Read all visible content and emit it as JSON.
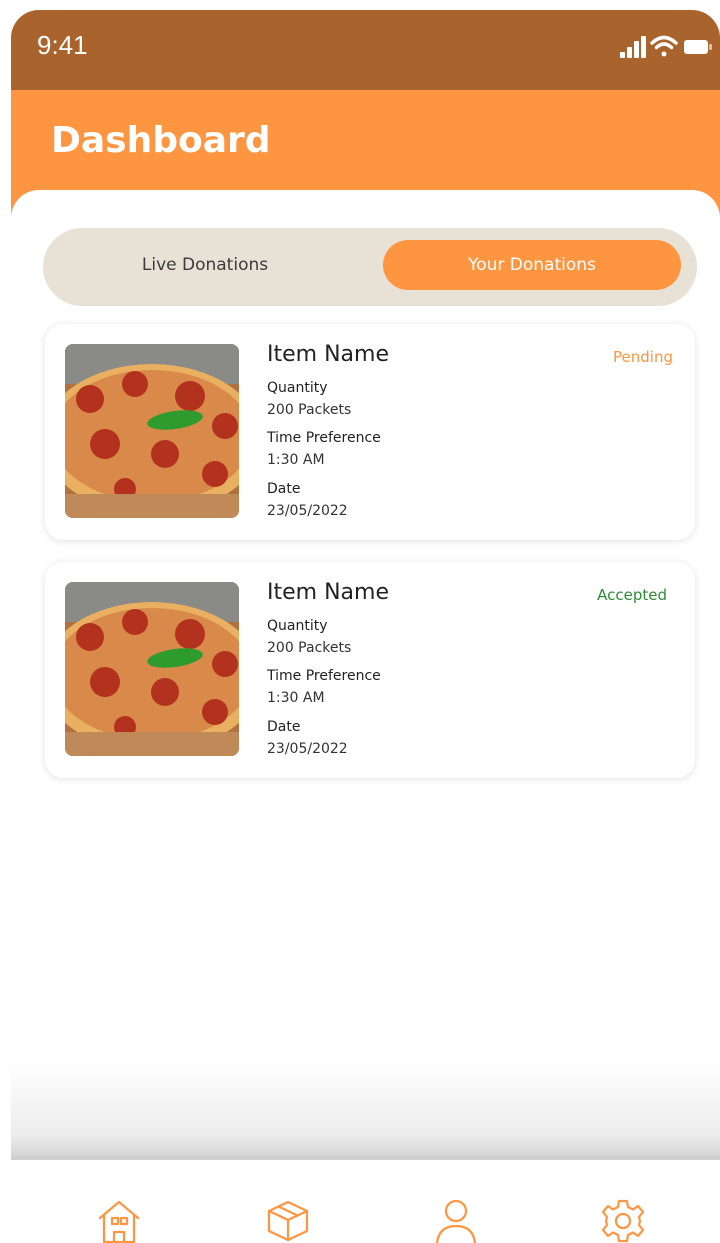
{
  "status_bar": {
    "time": "9:41",
    "icons": [
      "signal-icon",
      "wifi-icon",
      "battery-icon"
    ]
  },
  "header": {
    "title": "Dashboard"
  },
  "tabs": [
    {
      "label": "Live Donations",
      "active": false
    },
    {
      "label": "Your Donations",
      "active": true
    }
  ],
  "donations": [
    {
      "name": "Item Name",
      "status": "Pending",
      "quantity_label": "Quantity",
      "quantity": "200 Packets",
      "time_label": "Time Preference",
      "time": "1:30 AM",
      "date_label": "Date",
      "date": "23/05/2022"
    },
    {
      "name": "Item Name",
      "status": "Accepted",
      "quantity_label": "Quantity",
      "quantity": "200 Packets",
      "time_label": "Time Preference",
      "time": "1:30 AM",
      "date_label": "Date",
      "date": "23/05/2022"
    }
  ],
  "bottom_nav": [
    "home-icon",
    "box-icon",
    "user-icon",
    "gear-icon"
  ],
  "colors": {
    "status_bar": "#A8642C",
    "accent": "#FE9540",
    "segment_bg": "#E8E2D6",
    "accepted": "#2E8B35"
  }
}
